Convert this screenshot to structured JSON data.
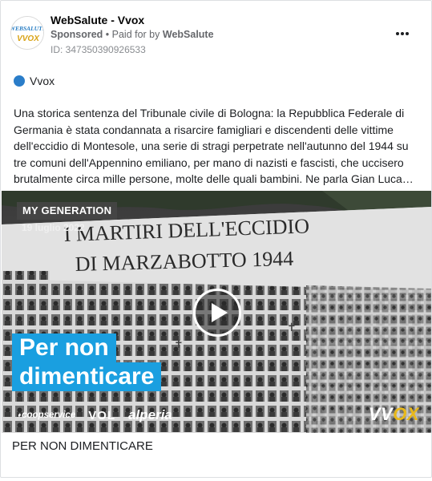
{
  "post": {
    "page_name": "WebSalute - Vvox",
    "sponsored": "Sponsored",
    "paid_prefix": "• Paid for by",
    "paid_by": "WebSalute",
    "ad_id": "ID: 347350390926533",
    "platform": "Vvox",
    "body": "Una storica sentenza del Tribunale civile di Bologna: la Repubblica Federale di Germania è stata condannata a risarcire famigliari e discendenti delle vittime dell'eccidio di Montesole, una serie di stragi perpetrate nell'autunno del 1944 su tre comuni dell'Appennino emiliano, per mano di nazisti e fascisti, che uccisero brutalmente circa mille persone, molte delle quali bambini. Ne parla Gian Luca…",
    "avatar_text_1": "WEBSALUTE",
    "avatar_text_2": "VVOX"
  },
  "media": {
    "tag": "MY GENERATION",
    "date": "19 luglio 2022",
    "monument_line_1": "I MARTIRI DELL'ECCIDIO",
    "monument_line_2": "DI MARZABOTTO 1944",
    "headline_1": "Per non",
    "headline_2": "dimenticare",
    "sponsor_1": "coopservice",
    "sponsor_2": "VOL",
    "sponsor_3": "alperia",
    "brand_logo_a": "VV",
    "brand_logo_b": "OX"
  },
  "caption": "PER NON DIMENTICARE",
  "colors": {
    "accent_blue": "#1a9fe0",
    "platform_dot": "#2a7dc9",
    "vvox_gold": "#e8b81a"
  },
  "icons": {
    "more": "more-horizontal-icon",
    "play": "play-icon"
  }
}
